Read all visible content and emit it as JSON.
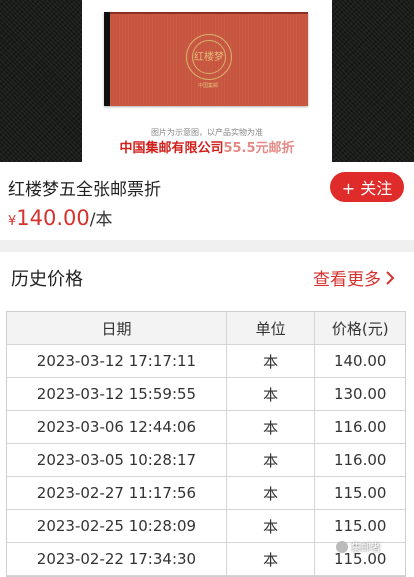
{
  "hero": {
    "seal_text": "红楼梦",
    "seal_caption": "中国集邮",
    "note": "图片为示意图，以产品实物为准",
    "promo_main": "中国集邮有限公司",
    "promo_overlay": "55.5元邮折"
  },
  "product": {
    "title": "红楼梦五全张邮票折",
    "follow_label": "+ 关注",
    "price_symbol": "¥",
    "price": "140.00",
    "price_unit": "/本"
  },
  "history": {
    "title": "历史价格",
    "more_label": "查看更多",
    "columns": [
      "日期",
      "单位",
      "价格(元)"
    ],
    "rows": [
      {
        "date": "2023-03-12 17:17:11",
        "unit": "本",
        "price": "140.00"
      },
      {
        "date": "2023-03-12 15:59:55",
        "unit": "本",
        "price": "130.00"
      },
      {
        "date": "2023-03-06 12:44:06",
        "unit": "本",
        "price": "116.00"
      },
      {
        "date": "2023-03-05 10:28:17",
        "unit": "本",
        "price": "116.00"
      },
      {
        "date": "2023-02-27 11:17:56",
        "unit": "本",
        "price": "115.00"
      },
      {
        "date": "2023-02-25 10:28:09",
        "unit": "本",
        "price": "115.00"
      },
      {
        "date": "2023-02-22 17:34:30",
        "unit": "本",
        "price": "115.00"
      }
    ]
  },
  "watermark": {
    "text": "集邮者"
  },
  "colors": {
    "accent": "#e02b2b",
    "price": "#d6322e"
  }
}
